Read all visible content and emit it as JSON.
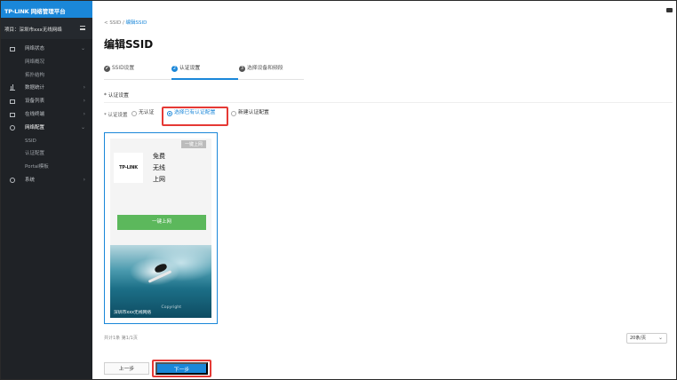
{
  "sidebar": {
    "brand_logo": "TP-LINK",
    "brand_title": "网络管理平台",
    "project_label": "项目：深圳市xxx无线网络",
    "items": [
      {
        "label": "网络状态",
        "icon": "monitor-icon",
        "chevron": "⌄"
      },
      {
        "label": "网络概况"
      },
      {
        "label": "拓扑结构"
      },
      {
        "label": "数据统计",
        "icon": "bar-chart-icon",
        "chevron": "›"
      },
      {
        "label": "设备列表",
        "icon": "device-list-icon",
        "chevron": "›"
      },
      {
        "label": "在线终端",
        "icon": "terminal-icon",
        "chevron": "›"
      },
      {
        "label": "网络配置",
        "icon": "gear-icon",
        "chevron": "⌄"
      },
      {
        "label": "SSID"
      },
      {
        "label": "认证配置"
      },
      {
        "label": "Portal模板"
      },
      {
        "label": "系统",
        "icon": "system-gear-icon",
        "chevron": "›"
      }
    ]
  },
  "breadcrumb": {
    "prefix": "< SSID / ",
    "current": "编辑SSID"
  },
  "page_title": "编辑SSID",
  "steps": [
    {
      "num": "✔",
      "label": "SSID设置"
    },
    {
      "num": "2",
      "label": "认证设置"
    },
    {
      "num": "3",
      "label": "选择设备和频段"
    }
  ],
  "section_title": "* 认证设置",
  "auth_field": {
    "label": "* 认证设置",
    "options": [
      "无认证",
      "选择已有认证配置",
      "新建认证配置"
    ],
    "selected": "选择已有认证配置"
  },
  "preview": {
    "tag": "一键上网",
    "logo": "TP-LINK",
    "slogan": "免费\n无线\n上网",
    "button": "一键上网",
    "ssid_caption": "深圳市xxx无线网络",
    "copyright": "Copyright"
  },
  "pagination": {
    "total": "共计1条  第1/1页",
    "page_size": "20条/页",
    "caret": "⌄"
  },
  "footer": {
    "prev": "上一步",
    "next": "下一步"
  },
  "colors": {
    "accent": "#1a87d9",
    "highlight": "#e53935",
    "sidebar_bg": "#1f2226",
    "connect_button": "#5cb85c"
  }
}
